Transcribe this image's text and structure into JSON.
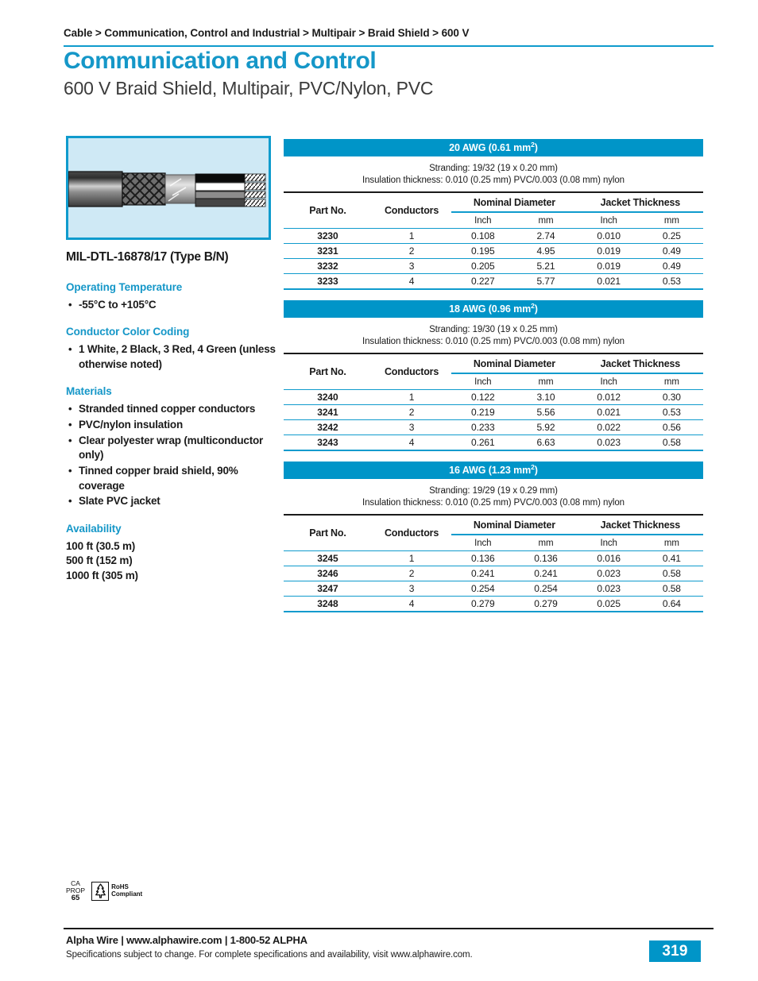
{
  "breadcrumb": "Cable > Communication, Control and Industrial > Multipair > Braid Shield > 600 V",
  "title": "Communication and Control",
  "subtitle": "600 V Braid Shield, Multipair, PVC/Nylon, PVC",
  "accent_color": "#0095c8",
  "title_color": "#1597c8",
  "illustration": {
    "name": "cable-cutaway-illustration",
    "background": "#cfe9f5",
    "border_color": "#0f9bcd",
    "conductor_colors": [
      "#0a0a0a",
      "#ffffff",
      "#8c8c8c",
      "#454545"
    ]
  },
  "mil_spec": "MIL-DTL-16878/17 (Type B/N)",
  "sections": [
    {
      "heading": "Operating Temperature",
      "items": [
        "-55°C to +105°C"
      ]
    },
    {
      "heading": "Conductor Color Coding",
      "items": [
        "1 White, 2 Black, 3 Red, 4 Green (unless otherwise noted)"
      ]
    },
    {
      "heading": "Materials",
      "items": [
        "Stranded tinned copper conductors",
        "PVC/nylon insulation",
        "Clear polyester wrap (multiconductor only)",
        "Tinned copper braid shield, 90% coverage",
        "Slate PVC jacket"
      ]
    }
  ],
  "availability": {
    "heading": "Availability",
    "lines": [
      "100 ft (30.5 m)",
      "500 ft (152 m)",
      "1000 ft (305 m)"
    ]
  },
  "table_columns": {
    "part": "Part No.",
    "conductors": "Conductors",
    "nominal_diameter": "Nominal Diameter",
    "jacket_thickness": "Jacket Thickness",
    "inch": "Inch",
    "mm": "mm"
  },
  "tables": [
    {
      "title": "20 AWG (0.61 mm",
      "title_sup": "2",
      "title_tail": ")",
      "stranding": "Stranding: 19/32 (19 x 0.20 mm)",
      "insulation": "Insulation thickness: 0.010 (0.25 mm) PVC/0.003 (0.08 mm) nylon",
      "rows": [
        {
          "part": "3230",
          "conductors": "1",
          "od_in": "0.108",
          "od_mm": "2.74",
          "jkt_in": "0.010",
          "jkt_mm": "0.25"
        },
        {
          "part": "3231",
          "conductors": "2",
          "od_in": "0.195",
          "od_mm": "4.95",
          "jkt_in": "0.019",
          "jkt_mm": "0.49"
        },
        {
          "part": "3232",
          "conductors": "3",
          "od_in": "0.205",
          "od_mm": "5.21",
          "jkt_in": "0.019",
          "jkt_mm": "0.49"
        },
        {
          "part": "3233",
          "conductors": "4",
          "od_in": "0.227",
          "od_mm": "5.77",
          "jkt_in": "0.021",
          "jkt_mm": "0.53"
        }
      ]
    },
    {
      "title": "18 AWG (0.96 mm",
      "title_sup": "2",
      "title_tail": ")",
      "stranding": "Stranding: 19/30 (19 x 0.25 mm)",
      "insulation": "Insulation thickness: 0.010 (0.25 mm) PVC/0.003 (0.08 mm) nylon",
      "rows": [
        {
          "part": "3240",
          "conductors": "1",
          "od_in": "0.122",
          "od_mm": "3.10",
          "jkt_in": "0.012",
          "jkt_mm": "0.30"
        },
        {
          "part": "3241",
          "conductors": "2",
          "od_in": "0.219",
          "od_mm": "5.56",
          "jkt_in": "0.021",
          "jkt_mm": "0.53"
        },
        {
          "part": "3242",
          "conductors": "3",
          "od_in": "0.233",
          "od_mm": "5.92",
          "jkt_in": "0.022",
          "jkt_mm": "0.56"
        },
        {
          "part": "3243",
          "conductors": "4",
          "od_in": "0.261",
          "od_mm": "6.63",
          "jkt_in": "0.023",
          "jkt_mm": "0.58"
        }
      ]
    },
    {
      "title": "16 AWG (1.23 mm",
      "title_sup": "2",
      "title_tail": ")",
      "stranding": "Stranding: 19/29 (19 x 0.29 mm)",
      "insulation": "Insulation thickness: 0.010 (0.25 mm) PVC/0.003 (0.08 mm) nylon",
      "rows": [
        {
          "part": "3245",
          "conductors": "1",
          "od_in": "0.136",
          "od_mm": "0.136",
          "jkt_in": "0.016",
          "jkt_mm": "0.41"
        },
        {
          "part": "3246",
          "conductors": "2",
          "od_in": "0.241",
          "od_mm": "0.241",
          "jkt_in": "0.023",
          "jkt_mm": "0.58"
        },
        {
          "part": "3247",
          "conductors": "3",
          "od_in": "0.254",
          "od_mm": "0.254",
          "jkt_in": "0.023",
          "jkt_mm": "0.58"
        },
        {
          "part": "3248",
          "conductors": "4",
          "od_in": "0.279",
          "od_mm": "0.279",
          "jkt_in": "0.025",
          "jkt_mm": "0.64"
        }
      ]
    }
  ],
  "badges": {
    "ca_prop_line1": "CA",
    "ca_prop_line2": "PROP",
    "ca_prop_line3": "65",
    "rohs_line1": "RoHS",
    "rohs_line2": "Compliant"
  },
  "footer": {
    "main": "Alpha Wire | www.alphawire.com | 1-800-52 ALPHA",
    "sub": "Specifications subject to change. For complete specifications and availability, visit www.alphawire.com.",
    "page_number": "319"
  }
}
